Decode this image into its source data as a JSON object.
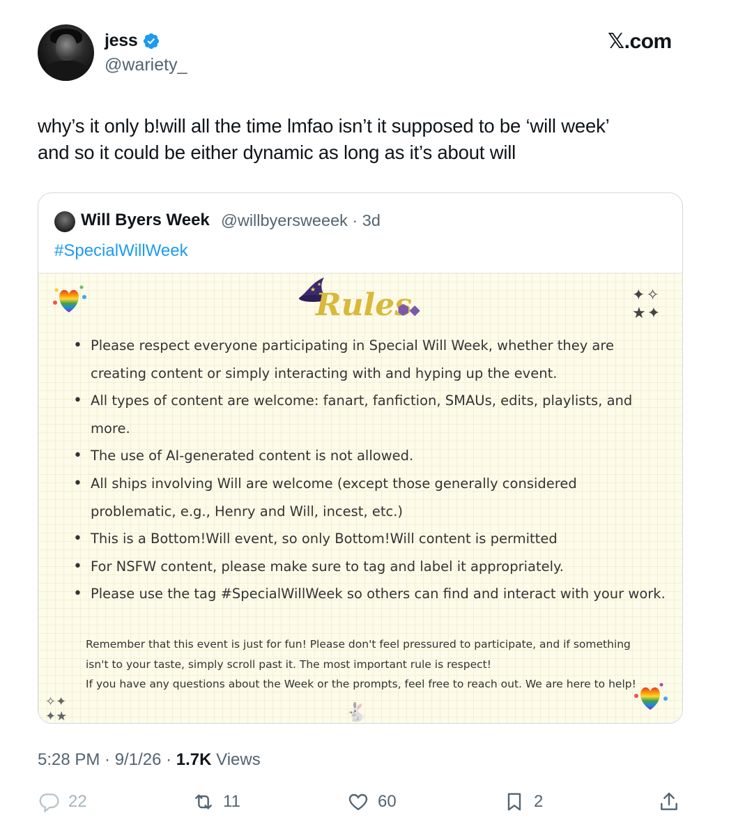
{
  "author": {
    "name": "jess",
    "handle": "@wariety_",
    "verified": true
  },
  "brand": "𝕏.com",
  "tweet": {
    "text_line1": "why’s it only b!will all the time lmfao isn’t it supposed to be ‘will week’",
    "text_line2": "and so it could be either dynamic as long as it’s about will"
  },
  "quote": {
    "name": "Will Byers Week",
    "handle_time": "@willbyersweeek · 3d",
    "hashtag": "#SpecialWillWeek",
    "image": {
      "title": "Rules",
      "rules": [
        "Please respect everyone participating in Special Will Week, whether they are creating content or simply interacting with and hyping up the event.",
        "All types of content are welcome: fanart, fanfiction, SMAUs, edits, playlists, and more.",
        "The use of AI-generated content is not allowed.",
        "All ships involving Will are welcome (except those generally considered problematic, e.g., Henry and Will, incest, etc.)",
        "This is a Bottom!Will event, so only Bottom!Will content is permitted",
        "For NSFW content, please make sure to tag and label it appropriately.",
        "Please use the tag #SpecialWillWeek so others can find and interact with your work."
      ],
      "footnote_line1": "Remember that this event is just for fun! Please don't feel pressured to participate, and if something",
      "footnote_line2": "isn't to your taste, simply scroll past it. The most important rule is respect!",
      "footnote_line3": "If you have any questions about the Week or the prompts, feel free to reach out. We are here to help!"
    }
  },
  "meta": {
    "time_date": "5:28 PM · 9/1/26 · ",
    "views_count": "1.7K",
    "views_label": " Views"
  },
  "actions": {
    "replies": "22",
    "reposts": "11",
    "likes": "60",
    "bookmarks": "2"
  },
  "colors": {
    "link": "#1d9bf0",
    "verified": "#1d9bf0",
    "secondary_text": "#536471"
  },
  "icons": [
    "verified-badge-icon",
    "reply-icon",
    "retweet-icon",
    "heart-icon",
    "bookmark-icon",
    "share-icon"
  ]
}
